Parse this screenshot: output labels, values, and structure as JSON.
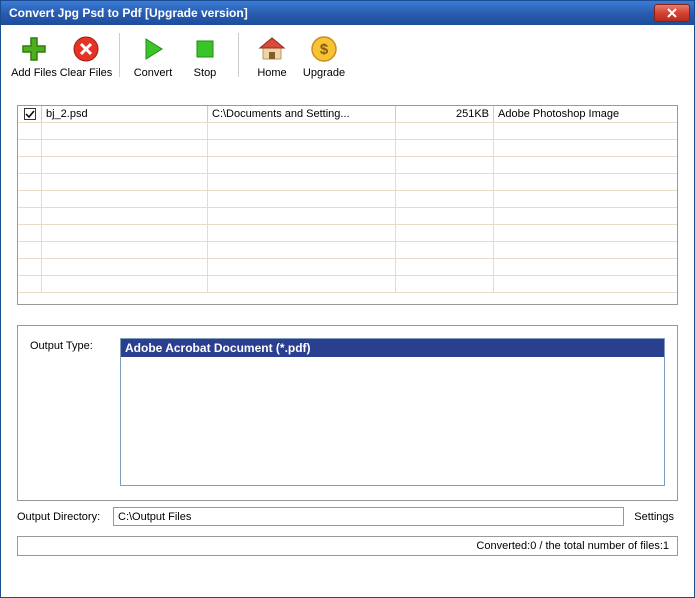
{
  "window": {
    "title": "Convert Jpg Psd to Pdf [Upgrade version]"
  },
  "toolbar": {
    "addFiles": "Add Files",
    "clearFiles": "Clear Files",
    "convert": "Convert",
    "stop": "Stop",
    "home": "Home",
    "upgrade": "Upgrade"
  },
  "files": [
    {
      "checked": true,
      "name": "bj_2.psd",
      "path": "C:\\Documents and Setting...",
      "size": "251KB",
      "type": "Adobe Photoshop Image"
    }
  ],
  "output": {
    "typeLabel": "Output Type:",
    "selectedType": "Adobe Acrobat Document (*.pdf)",
    "dirLabel": "Output Directory:",
    "directory": "C:\\Output Files",
    "settingsLabel": "Settings"
  },
  "status": {
    "text": "Converted:0  /  the total number of files:1"
  }
}
